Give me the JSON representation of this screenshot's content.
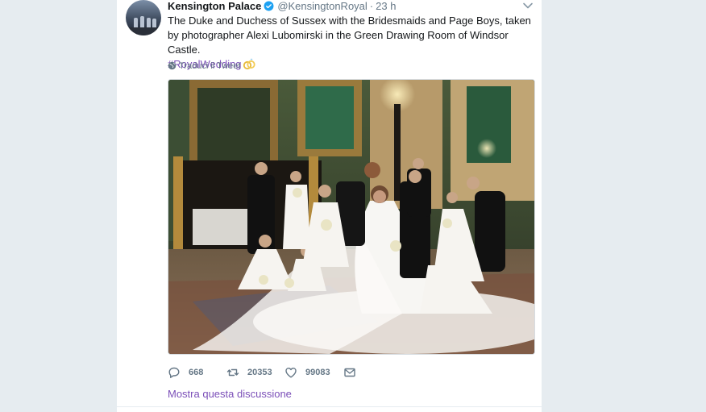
{
  "tweet": {
    "display_name": "Kensington Palace",
    "handle": "@KensingtonRoyal",
    "separator": "·",
    "time": "23 h",
    "text": "The Duke and Duchess of Sussex with the Bridesmaids and Page Boys, taken by photographer Alexi Lubomirski in the Green Drawing Room of Windsor Castle.",
    "hashtag": "#RoyalWedding",
    "translate_label": "Traduci il Tweet",
    "replies": "668",
    "retweets": "20353",
    "likes": "99083",
    "show_thread": "Mostra questa discussione"
  },
  "icons": {
    "verified": "verified-badge-icon",
    "caret": "chevron-down-icon",
    "globe": "globe-icon",
    "reply": "reply-icon",
    "retweet": "retweet-icon",
    "like": "heart-icon",
    "dm": "envelope-icon",
    "emoji": "wedding-rings-emoji"
  },
  "colors": {
    "text": "#14171a",
    "secondary": "#657786",
    "link": "#7b4fb8",
    "verified": "#1da1f2",
    "page_background": "#e6ecf0",
    "card_background": "#ffffff"
  }
}
